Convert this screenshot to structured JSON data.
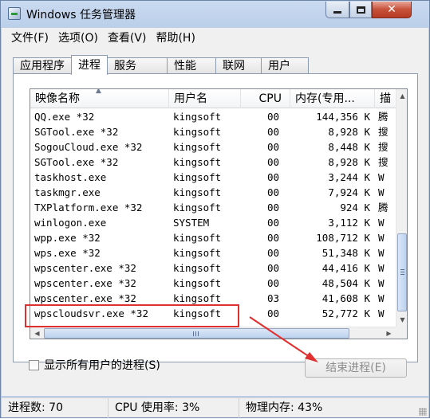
{
  "window": {
    "title": "Windows 任务管理器"
  },
  "menu": [
    {
      "label": "文件(F)"
    },
    {
      "label": "选项(O)"
    },
    {
      "label": "查看(V)"
    },
    {
      "label": "帮助(H)"
    }
  ],
  "tabs": [
    {
      "label": "应用程序",
      "active": false
    },
    {
      "label": "进程",
      "active": true
    },
    {
      "label": "服务",
      "active": false
    },
    {
      "label": "性能",
      "active": false
    },
    {
      "label": "联网",
      "active": false
    },
    {
      "label": "用户",
      "active": false
    }
  ],
  "columns": {
    "name": "映像名称",
    "user": "用户名",
    "cpu": "CPU",
    "mem": "内存(专用...",
    "desc": "描"
  },
  "processes": [
    {
      "name": "QQ.exe *32",
      "user": "kingsoft",
      "cpu": "00",
      "mem": "144,356 K",
      "desc": "腾"
    },
    {
      "name": "SGTool.exe *32",
      "user": "kingsoft",
      "cpu": "00",
      "mem": "8,928 K",
      "desc": "搜"
    },
    {
      "name": "SogouCloud.exe *32",
      "user": "kingsoft",
      "cpu": "00",
      "mem": "8,448 K",
      "desc": "搜"
    },
    {
      "name": "SGTool.exe *32",
      "user": "kingsoft",
      "cpu": "00",
      "mem": "8,928 K",
      "desc": "搜"
    },
    {
      "name": "taskhost.exe",
      "user": "kingsoft",
      "cpu": "00",
      "mem": "3,244 K",
      "desc": "W"
    },
    {
      "name": "taskmgr.exe",
      "user": "kingsoft",
      "cpu": "00",
      "mem": "7,924 K",
      "desc": "W"
    },
    {
      "name": "TXPlatform.exe *32",
      "user": "kingsoft",
      "cpu": "00",
      "mem": "924 K",
      "desc": "腾"
    },
    {
      "name": "winlogon.exe",
      "user": "SYSTEM",
      "cpu": "00",
      "mem": "3,112 K",
      "desc": "W"
    },
    {
      "name": "wpp.exe *32",
      "user": "kingsoft",
      "cpu": "00",
      "mem": "108,712 K",
      "desc": "W"
    },
    {
      "name": "wps.exe *32",
      "user": "kingsoft",
      "cpu": "00",
      "mem": "51,348 K",
      "desc": "W"
    },
    {
      "name": "wpscenter.exe *32",
      "user": "kingsoft",
      "cpu": "00",
      "mem": "44,416 K",
      "desc": "W"
    },
    {
      "name": "wpscenter.exe *32",
      "user": "kingsoft",
      "cpu": "00",
      "mem": "48,504 K",
      "desc": "W"
    },
    {
      "name": "wpscenter.exe *32",
      "user": "kingsoft",
      "cpu": "03",
      "mem": "41,608 K",
      "desc": "W"
    },
    {
      "name": "wpscloudsvr.exe *32",
      "user": "kingsoft",
      "cpu": "00",
      "mem": "52,772 K",
      "desc": "W"
    }
  ],
  "show_all_users": {
    "label": "显示所有用户的进程(S)",
    "checked": false
  },
  "end_process": {
    "label": "结束进程(E)",
    "enabled": false
  },
  "status": {
    "processes": "进程数: 70",
    "cpu": "CPU 使用率: 3%",
    "memory": "物理内存: 43%"
  },
  "annotation": {
    "color": "#e02f2f"
  },
  "icons": {
    "minimize": "minimize-icon",
    "maximize": "maximize-icon",
    "close": "close-icon"
  }
}
